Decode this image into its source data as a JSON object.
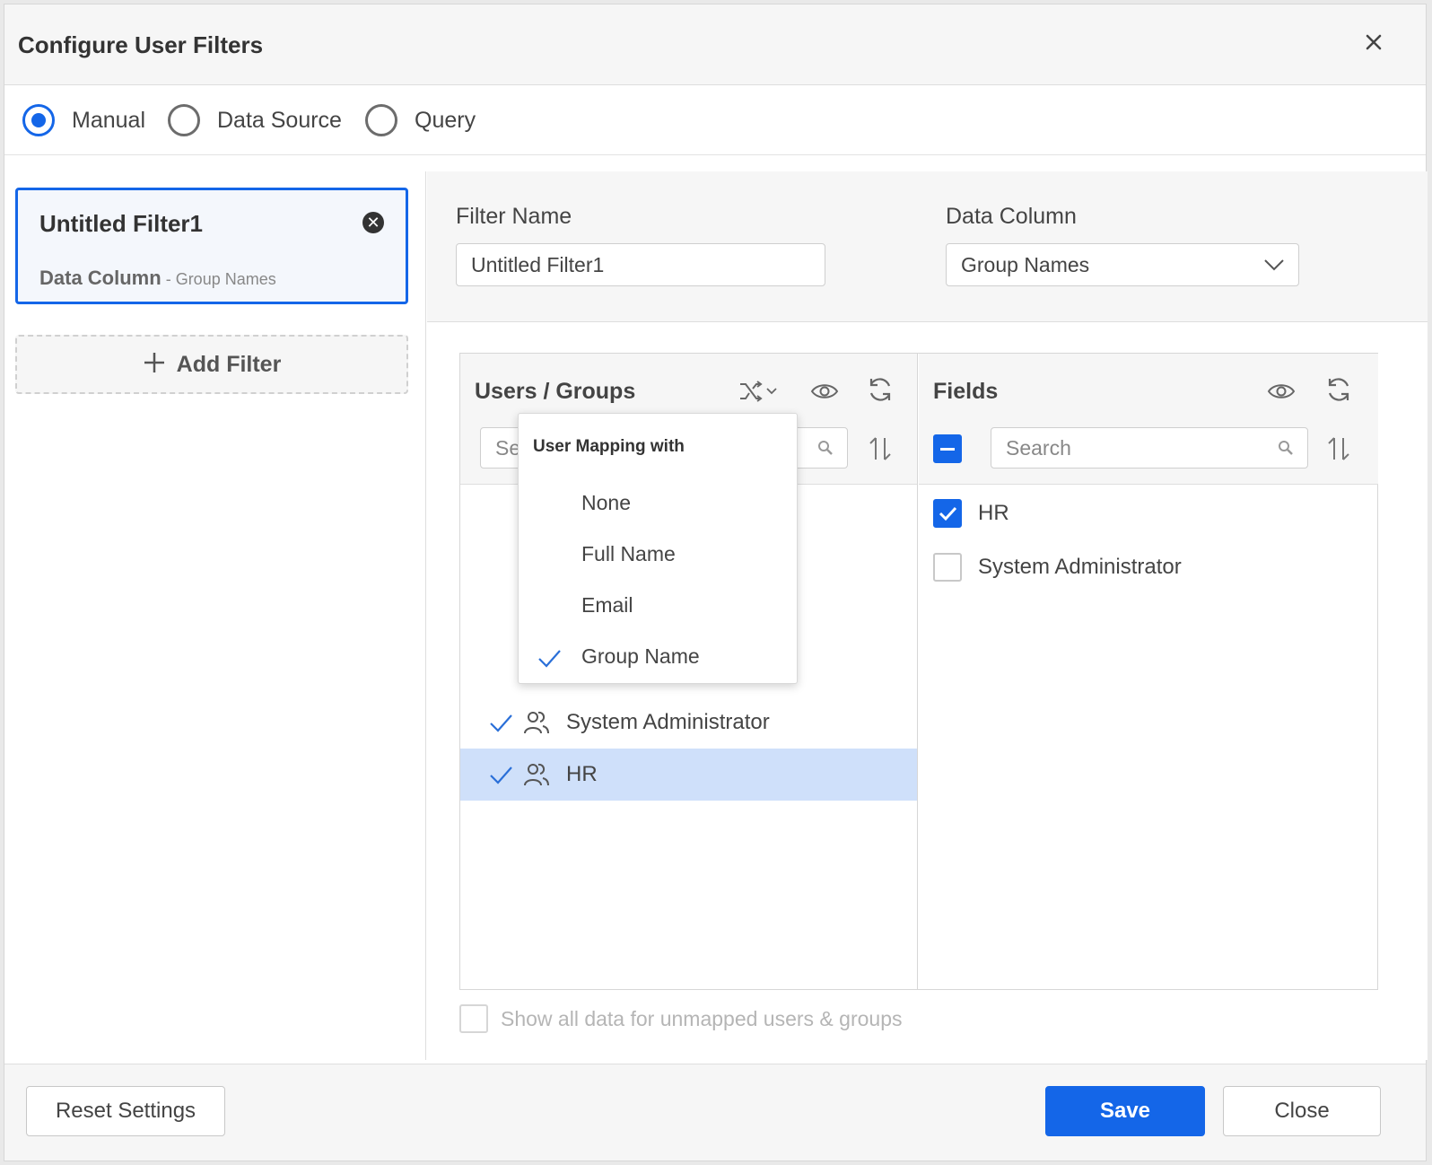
{
  "dialog": {
    "title": "Configure User Filters",
    "close_icon": "close-icon"
  },
  "filter_mode": {
    "options": [
      {
        "label": "Manual",
        "checked": true
      },
      {
        "label": "Data Source",
        "checked": false
      },
      {
        "label": "Query",
        "checked": false
      }
    ]
  },
  "sidebar": {
    "filters": [
      {
        "name": "Untitled Filter1",
        "column_label": "Data Column",
        "column_separator": " - ",
        "column_value": "Group Names"
      }
    ],
    "add_filter_label": "Add Filter"
  },
  "config": {
    "filter_name_label": "Filter Name",
    "filter_name_value": "Untitled Filter1",
    "data_column_label": "Data Column",
    "data_column_value": "Group Names"
  },
  "users_groups": {
    "title": "Users / Groups",
    "search_placeholder": "Se",
    "rows": [
      {
        "label": "System Administrator",
        "mapped": true,
        "selected": false
      },
      {
        "label": "HR",
        "mapped": true,
        "selected": true
      }
    ]
  },
  "mapping_popup": {
    "title": "User Mapping with",
    "options": [
      {
        "label": "None",
        "checked": false
      },
      {
        "label": "Full Name",
        "checked": false
      },
      {
        "label": "Email",
        "checked": false
      },
      {
        "label": "Group Name",
        "checked": true
      }
    ]
  },
  "fields": {
    "title": "Fields",
    "search_placeholder": "Search",
    "rows": [
      {
        "label": "HR",
        "checked": true
      },
      {
        "label": "System Administrator",
        "checked": false
      }
    ]
  },
  "unmapped_label": "Show all data for unmapped users & groups",
  "footer": {
    "reset_label": "Reset Settings",
    "save_label": "Save",
    "close_label": "Close"
  },
  "colors": {
    "accent": "#1466e8",
    "selected_row": "#cfe0fa"
  }
}
